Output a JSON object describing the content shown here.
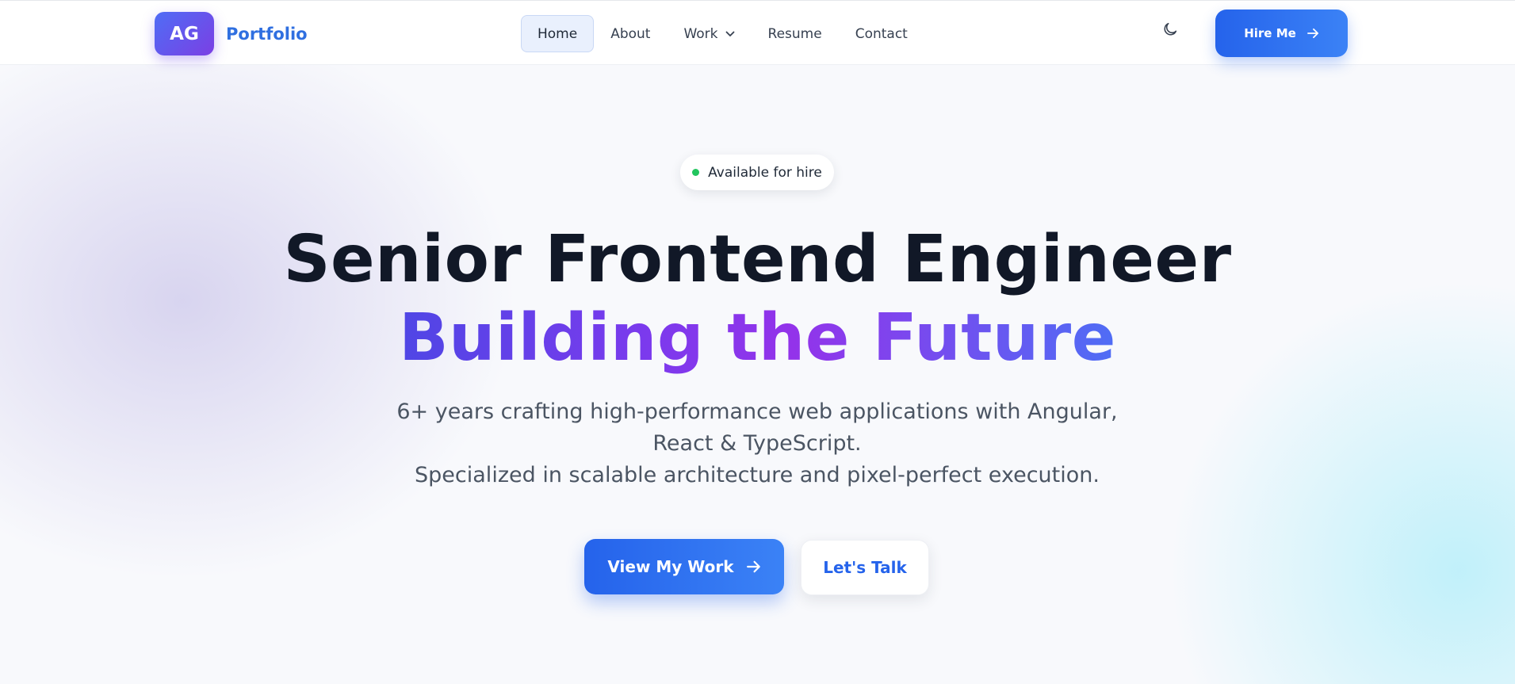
{
  "header": {
    "logo_initials": "AG",
    "brand_name": "Portfolio",
    "nav": [
      {
        "label": "Home",
        "active": true
      },
      {
        "label": "About",
        "active": false
      },
      {
        "label": "Work",
        "active": false,
        "has_dropdown": true
      },
      {
        "label": "Resume",
        "active": false
      },
      {
        "label": "Contact",
        "active": false
      }
    ],
    "theme_toggle_icon": "moon-icon",
    "hire_button_label": "Hire Me",
    "hire_button_icon": "arrow-right-icon"
  },
  "hero": {
    "status_label": "Available for hire",
    "status_color": "#22c55e",
    "headline_line1": "Senior Frontend Engineer",
    "headline_line2": "Building the Future",
    "subtitle_lines": [
      "6+ years crafting high-performance web applications with Angular,",
      "React & TypeScript.",
      "Specialized in scalable architecture and pixel-perfect execution."
    ],
    "primary_cta_label": "View My Work",
    "primary_cta_icon": "arrow-right-icon",
    "secondary_cta_label": "Let's Talk"
  },
  "colors": {
    "accent": "#2563eb",
    "brand_text": "#2f6fe0",
    "headline": "#111827",
    "gradient_start": "#4f46e5",
    "gradient_mid": "#9333ea",
    "gradient_end": "#4f6df5"
  }
}
